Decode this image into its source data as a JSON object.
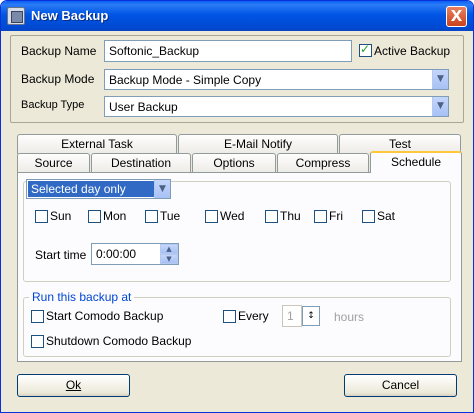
{
  "window": {
    "title": "New Backup",
    "close_label": "X"
  },
  "backup": {
    "name_label": "Backup Name",
    "name_value": "Softonic_Backup",
    "active_label": "Active Backup",
    "active_checked": true,
    "mode_label": "Backup Mode",
    "mode_value": "Backup Mode - Simple Copy",
    "type_label": "Backup Type",
    "type_value": "User Backup"
  },
  "tabs": {
    "row1": [
      "External Task",
      "E-Mail Notify",
      "Test"
    ],
    "row2": [
      "Source",
      "Destination",
      "Options",
      "Compress",
      "Schedule"
    ],
    "active": "Schedule"
  },
  "schedule": {
    "frequency": "Selected day only",
    "days": [
      "Sun",
      "Mon",
      "Tue",
      "Wed",
      "Thu",
      "Fri",
      "Sat"
    ],
    "start_time_label": "Start time",
    "start_time_value": "0:00:00"
  },
  "run_at": {
    "title": "Run this backup at",
    "start_comodo": "Start Comodo Backup",
    "every_label": "Every",
    "every_value": "1",
    "hours_label": "hours",
    "shutdown_comodo": "Shutdown Comodo Backup"
  },
  "buttons": {
    "ok": "Ok",
    "cancel": "Cancel"
  }
}
